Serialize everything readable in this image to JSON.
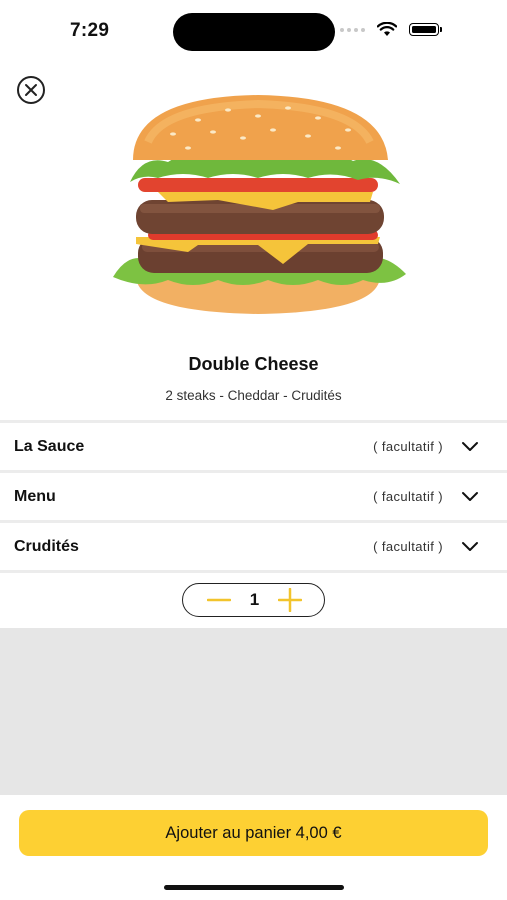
{
  "status_bar": {
    "time": "7:29"
  },
  "product": {
    "title": "Double Cheese",
    "description": "2 steaks - Cheddar - Crudités"
  },
  "options": [
    {
      "label": "La Sauce",
      "tag": "( facultatif )"
    },
    {
      "label": "Menu",
      "tag": "( facultatif )"
    },
    {
      "label": "Crudités",
      "tag": "( facultatif )"
    }
  ],
  "quantity": {
    "value": "1"
  },
  "cart_button": {
    "label": "Ajouter au panier 4,00 €"
  },
  "colors": {
    "accent": "#fdd033",
    "background_gray": "#e6e6e6"
  },
  "icons": {
    "close": "close-icon",
    "chevron": "chevron-down-icon",
    "minus": "minus-icon",
    "plus": "plus-icon"
  }
}
